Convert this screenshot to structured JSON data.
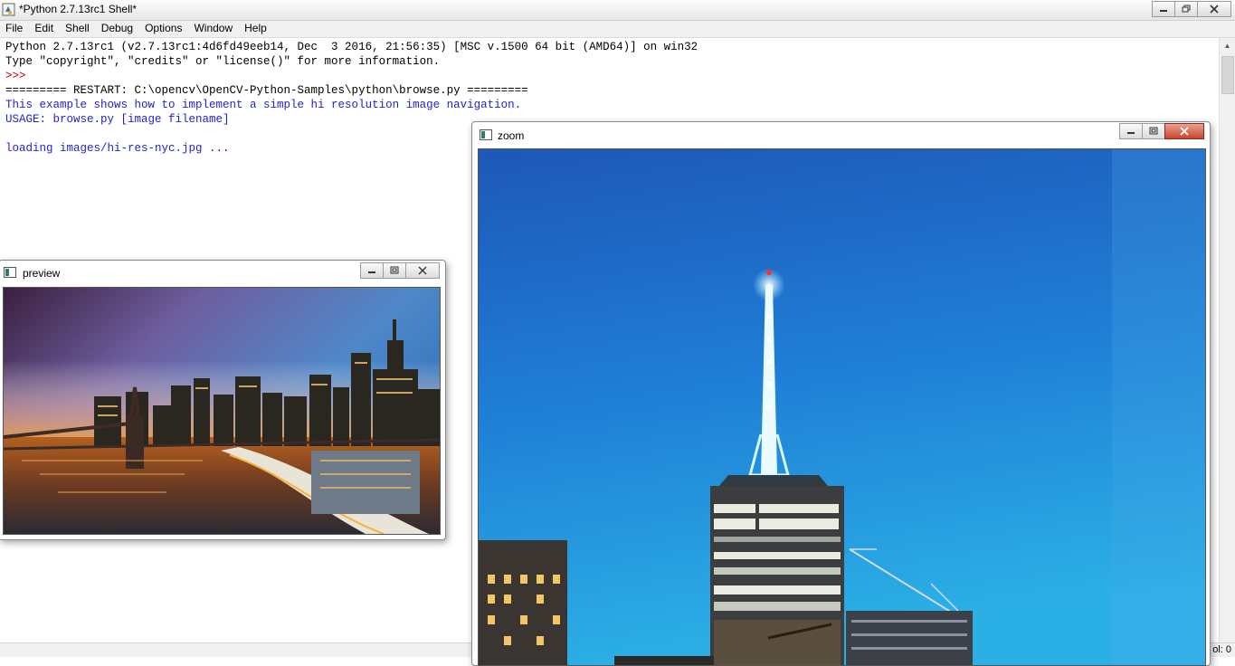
{
  "main_window": {
    "title": "*Python 2.7.13rc1 Shell*",
    "menu": [
      "File",
      "Edit",
      "Shell",
      "Debug",
      "Options",
      "Window",
      "Help"
    ]
  },
  "shell": {
    "lines": [
      "Python 2.7.13rc1 (v2.7.13rc1:4d6fd49eeb14, Dec  3 2016, 21:56:35) [MSC v.1500 64 bit (AMD64)] on win32",
      "Type \"copyright\", \"credits\" or \"license()\" for more information.",
      ">>> ",
      "========= RESTART: C:\\opencv\\OpenCV-Python-Samples\\python\\browse.py =========",
      "This example shows how to implement a simple hi resolution image navigation.",
      "USAGE: browse.py [image filename]",
      "",
      "loading images/hi-res-nyc.jpg ..."
    ]
  },
  "statusbar": {
    "col": "ol: 0"
  },
  "preview_window": {
    "title": "preview"
  },
  "zoom_window": {
    "title": "zoom"
  },
  "colors": {
    "prompt": "#c00000",
    "output": "#1f1fd0",
    "sky_top": "#1e57b8",
    "sky_bottom": "#2bb0e6"
  }
}
